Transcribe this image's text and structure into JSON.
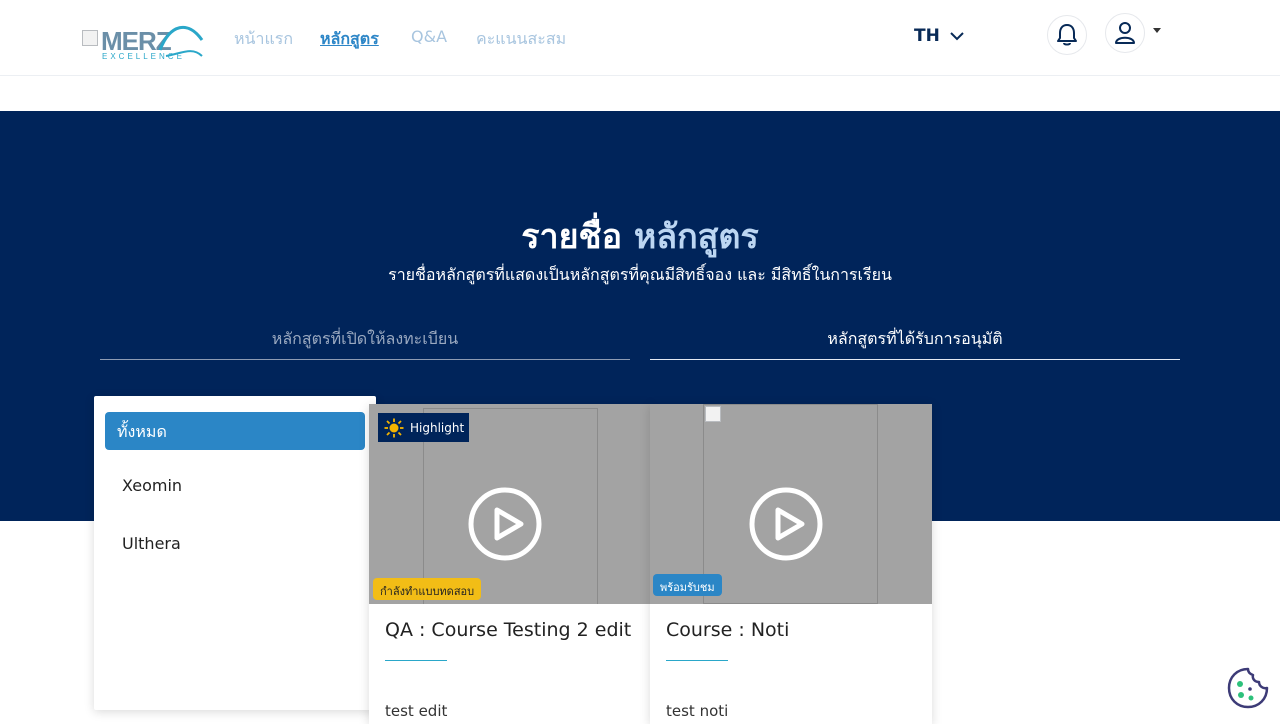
{
  "brand": {
    "logo_text": "MERZ",
    "logo_sub": "EXCELLENCE"
  },
  "nav": {
    "links": [
      {
        "label": "หน้าแรก",
        "active": false
      },
      {
        "label": "หลักสูตร",
        "active": true
      },
      {
        "label": "Q&A",
        "active": false
      },
      {
        "label": "คะแนนสะสม",
        "active": false
      }
    ],
    "language": "TH"
  },
  "icons": {
    "bell": "bell-icon",
    "user": "user-icon",
    "language_chevron": "chevron-down-icon",
    "play": "play-icon",
    "highlight": "sun-icon",
    "cookie": "cookie-icon"
  },
  "hero": {
    "title_prefix": "รายชื่อ",
    "title_highlight": "หลักสูตร",
    "subtitle": "รายชื่อหลักสูตรที่แสดงเป็นหลักสูตรที่คุณมีสิทธิ์จอง และ มีสิทธิ์ในการเรียน",
    "tabs": [
      {
        "label": "หลักสูตรที่เปิดให้ลงทะเบียน",
        "active": false
      },
      {
        "label": "หลักสูตรที่ได้รับการอนุมัติ",
        "active": true
      }
    ]
  },
  "categories": [
    {
      "label": "ทั้งหมด",
      "active": true
    },
    {
      "label": "Xeomin",
      "active": false
    },
    {
      "label": "Ulthera",
      "active": false
    }
  ],
  "courses": [
    {
      "highlight_label": "Highlight",
      "status": "กำลังทำแบบทดสอบ",
      "status_color": "#f2bd16",
      "title": "QA : Course Testing 2 edit",
      "description": "test edit"
    },
    {
      "highlight_label": "",
      "status": "พร้อมรับชม",
      "status_color": "#2b86c6",
      "title": "Course : Noti",
      "description": "test noti"
    }
  ],
  "colors": {
    "primary_dark": "#00245a",
    "accent_blue": "#2b86c6",
    "accent_cyan": "#2aa7c9",
    "nav_inactive": "#a8c5df",
    "status_yellow": "#f2bd16"
  }
}
